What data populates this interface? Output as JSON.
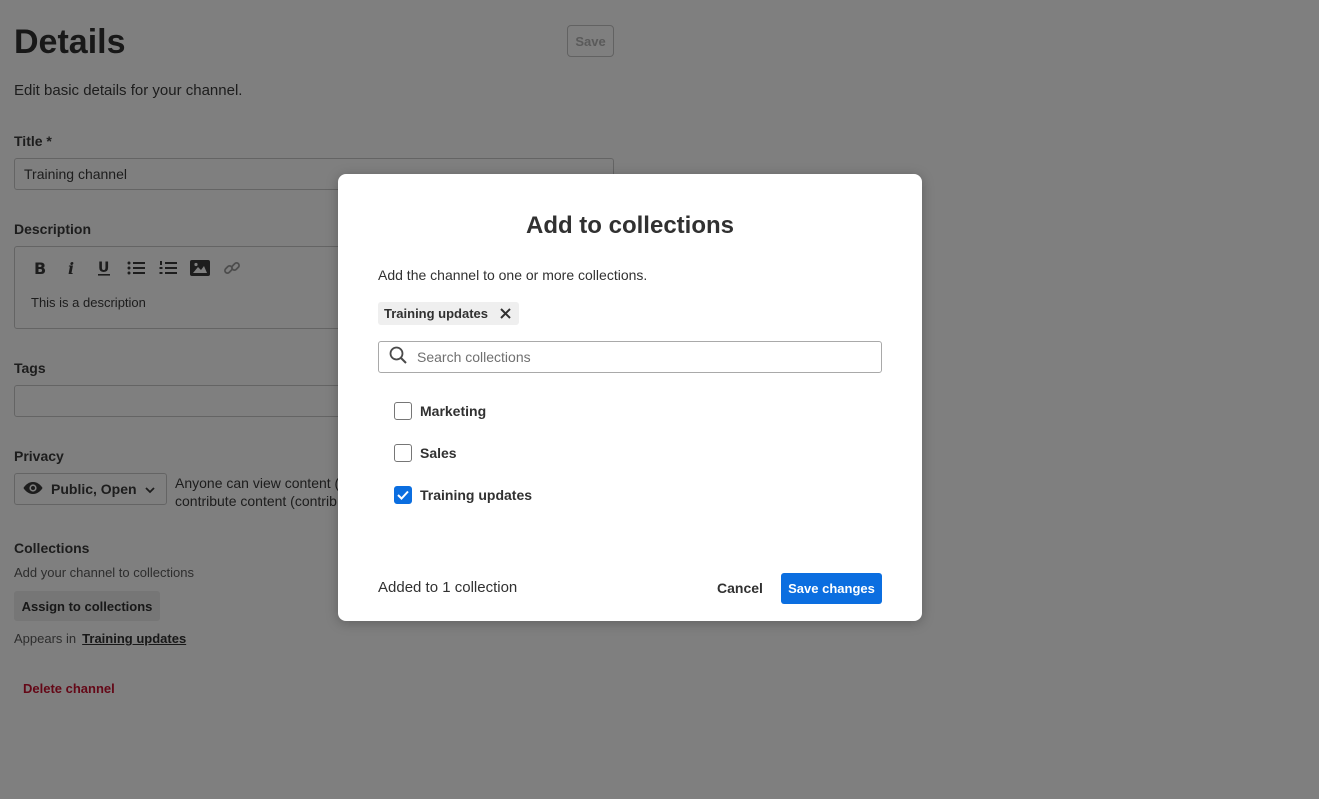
{
  "page": {
    "title": "Details",
    "save_label": "Save",
    "subtitle": "Edit basic details for your channel.",
    "title_label": "Title *",
    "title_value": "Training channel",
    "description_label": "Description",
    "description_text": "This is a description",
    "toolbar_icons": [
      "bold-icon",
      "italic-icon",
      "underline-icon",
      "bullet-list-icon",
      "numbered-list-icon",
      "image-icon",
      "link-icon"
    ],
    "tags_label": "Tags",
    "privacy_label": "Privacy",
    "privacy_value": "Public, Open",
    "privacy_desc_line1": "Anyone can view content (i",
    "privacy_desc_line2": "contribute content (contrib",
    "collections_label": "Collections",
    "collections_hint": "Add your channel to collections",
    "assign_label": "Assign to collections",
    "appears_in": "Appears in",
    "appears_link": "Training updates",
    "delete_label": "Delete channel"
  },
  "modal": {
    "title": "Add to collections",
    "description": "Add the channel to one or more collections.",
    "selected_chip": "Training updates",
    "search_placeholder": "Search collections",
    "options": [
      {
        "label": "Marketing",
        "checked": false
      },
      {
        "label": "Sales",
        "checked": false
      },
      {
        "label": "Training updates",
        "checked": true
      }
    ],
    "footer_status": "Added to 1 collection",
    "cancel_label": "Cancel",
    "save_label": "Save changes"
  },
  "colors": {
    "primary": "#0b6ee0",
    "danger": "#c8102e",
    "overlay": "rgba(0,0,0,0.5)"
  }
}
